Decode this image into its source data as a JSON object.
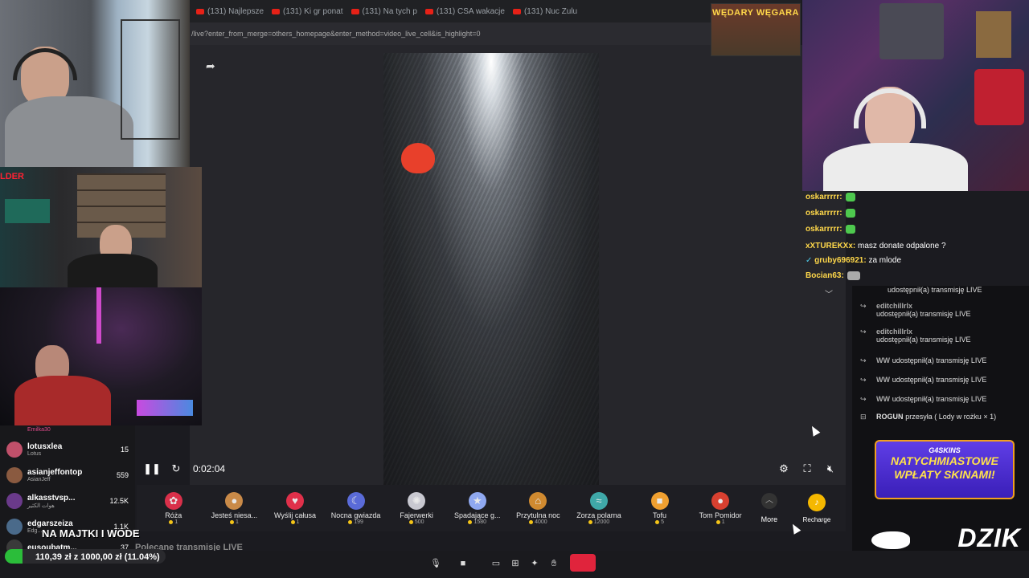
{
  "browser": {
    "tabs": [
      "(131) Najlepsze",
      "(131) Ki gr ponat",
      "(131) Na tych p",
      "(131) CSA wakacje",
      "(131) Nuc Zulu"
    ],
    "url": "/live?enter_from_merge=others_homepage&enter_method=video_live_cell&is_highlight=0"
  },
  "overlay_banner_top": "WĘDARY WĘGARA",
  "cam_label": "LDER",
  "player": {
    "time": "0:02:04",
    "gifts": [
      {
        "name": "Róża",
        "price": "1",
        "color": "#d9304a",
        "icon": "rose-icon"
      },
      {
        "name": "Jesteś niesa...",
        "price": "1",
        "color": "#c98a48",
        "icon": "cat-icon"
      },
      {
        "name": "Wyślij całusa",
        "price": "1",
        "color": "#e0304a",
        "icon": "lips-icon"
      },
      {
        "name": "Nocna gwiazda",
        "price": "199",
        "color": "#5a6bd8",
        "icon": "ghost-icon"
      },
      {
        "name": "Fajerwerki",
        "price": "500",
        "color": "#c8c8d0",
        "icon": "firework-icon"
      },
      {
        "name": "Spadające g...",
        "price": "1580",
        "color": "#8fa8f0",
        "icon": "star-icon"
      },
      {
        "name": "Przytulna noc",
        "price": "4000",
        "color": "#d08a30",
        "icon": "house-icon"
      },
      {
        "name": "Zorza polarna",
        "price": "12000",
        "color": "#3fa8a8",
        "icon": "aurora-icon"
      },
      {
        "name": "Tofu",
        "price": "5",
        "color": "#f0a030",
        "icon": "tofu-icon"
      },
      {
        "name": "Tom Pomidor",
        "price": "1",
        "color": "#d84030",
        "icon": "tomato-icon"
      }
    ],
    "more_label": "More",
    "recharge_label": "Recharge",
    "below_title": "Polecane transmisje LIVE"
  },
  "left_chat": [
    {
      "name": "Emilka30",
      "sub": "",
      "count": "",
      "color": "#e04a8a"
    },
    {
      "name": "lotusxlea",
      "sub": "Lotus",
      "count": "15",
      "color": "#c0506a"
    },
    {
      "name": "asianjeffontop",
      "sub": "AsianJeff",
      "count": "559",
      "color": "#8a5a40"
    },
    {
      "name": "alkasstvsp...",
      "sub": "هوات الكثير",
      "count": "12.5K",
      "color": "#6a3a8a"
    },
    {
      "name": "edgarszeiza",
      "sub": "Edg...",
      "count": "1.1K",
      "color": "#4a6a8a"
    },
    {
      "name": "eusoubatm...",
      "sub": "",
      "count": "37",
      "color": "#3a3a3a"
    }
  ],
  "overlay_text": "NA MAJTKI I WODE",
  "donation_goal": {
    "text": "110,39 zł z 1000,00 zł (11.04%)",
    "percent": 11.04
  },
  "overlay_chat": [
    {
      "name": "oskarrrrr:",
      "text": "",
      "emote": true
    },
    {
      "name": "oskarrrrr:",
      "text": "",
      "emote": true
    },
    {
      "name": "oskarrrrr:",
      "text": "",
      "emote": true
    },
    {
      "name": "xXTUREKXx:",
      "text": "masz donate odpalone ?",
      "emote": false
    },
    {
      "name": "gruby696921:",
      "text": "za mlode",
      "emote": false
    },
    {
      "name": "Bocian63:",
      "text": "",
      "emote": false
    }
  ],
  "right_chat": [
    {
      "icon": "share-icon",
      "name": "editchillrlx",
      "text": "udostępnił(a) transmisję LIVE"
    },
    {
      "icon": "share-icon",
      "name": "editchillrlx",
      "text": "udostępnił(a) transmisję LIVE"
    },
    {
      "icon": "share-icon",
      "name": "editchillrlx",
      "text": "udostępnił(a) transmisję LIVE"
    },
    {
      "icon": "share-icon",
      "name": "WW",
      "text": "udostępnił(a) transmisję LIVE"
    },
    {
      "icon": "share-icon",
      "name": "WW",
      "text": "udostępnił(a) transmisję LIVE"
    },
    {
      "icon": "share-icon",
      "name": "WW",
      "text": "udostępnił(a) transmisję LIVE"
    },
    {
      "icon": "gift-icon",
      "name": "ROGUN",
      "text": "przesyła ( Lody w rożku × 1)"
    }
  ],
  "ad": {
    "brand": "G4SKINS",
    "line1": "NATYCHMIASTOWE",
    "line2": "WPŁATY SKINAMI!"
  },
  "dzik_logo": "DZIK"
}
